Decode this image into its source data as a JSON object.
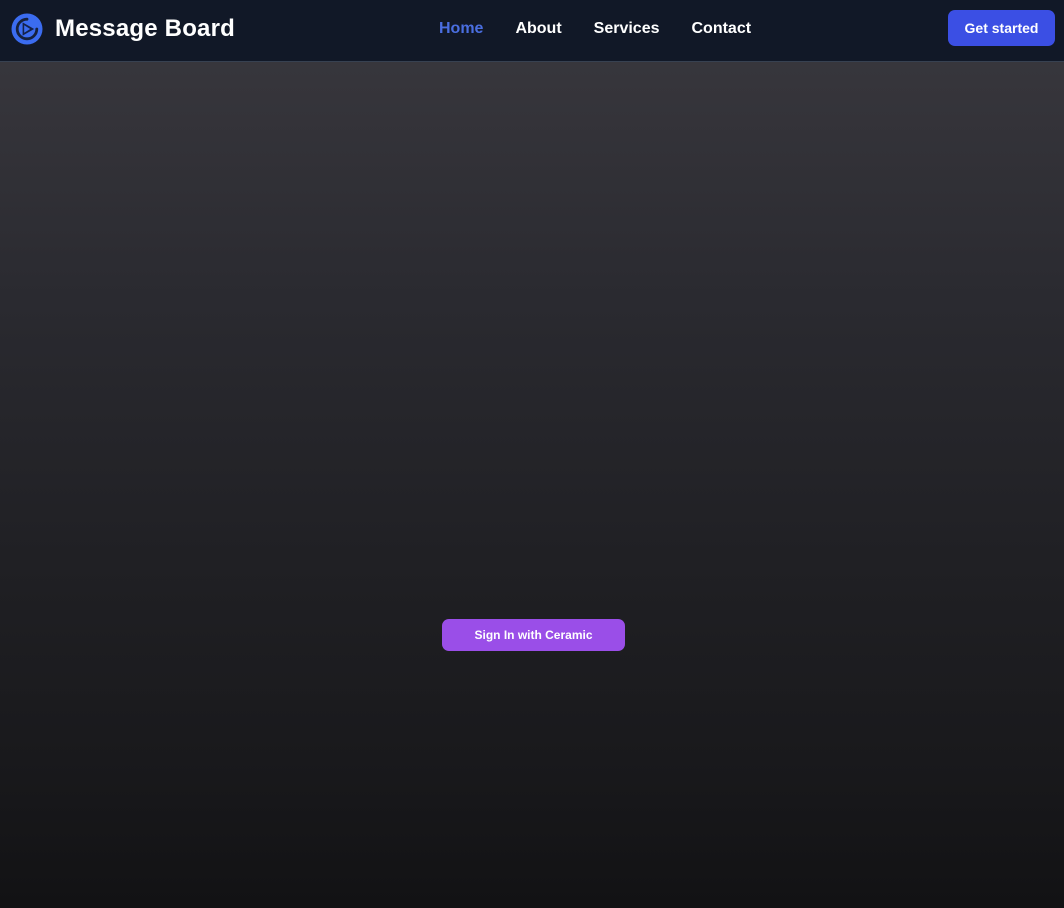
{
  "header": {
    "brand_name": "Message Board",
    "logo_icon": "play-circle-icon",
    "nav": [
      {
        "label": "Home",
        "active": true
      },
      {
        "label": "About",
        "active": false
      },
      {
        "label": "Services",
        "active": false
      },
      {
        "label": "Contact",
        "active": false
      }
    ],
    "cta_label": "Get started"
  },
  "main": {
    "signin_label": "Sign In with Ceramic"
  },
  "colors": {
    "navbar_background": "#111827",
    "nav_active": "#4a6ee0",
    "cta_background": "#3b4fe4",
    "signin_background": "#9a4ee8",
    "logo_blue": "#3b6cf0"
  }
}
